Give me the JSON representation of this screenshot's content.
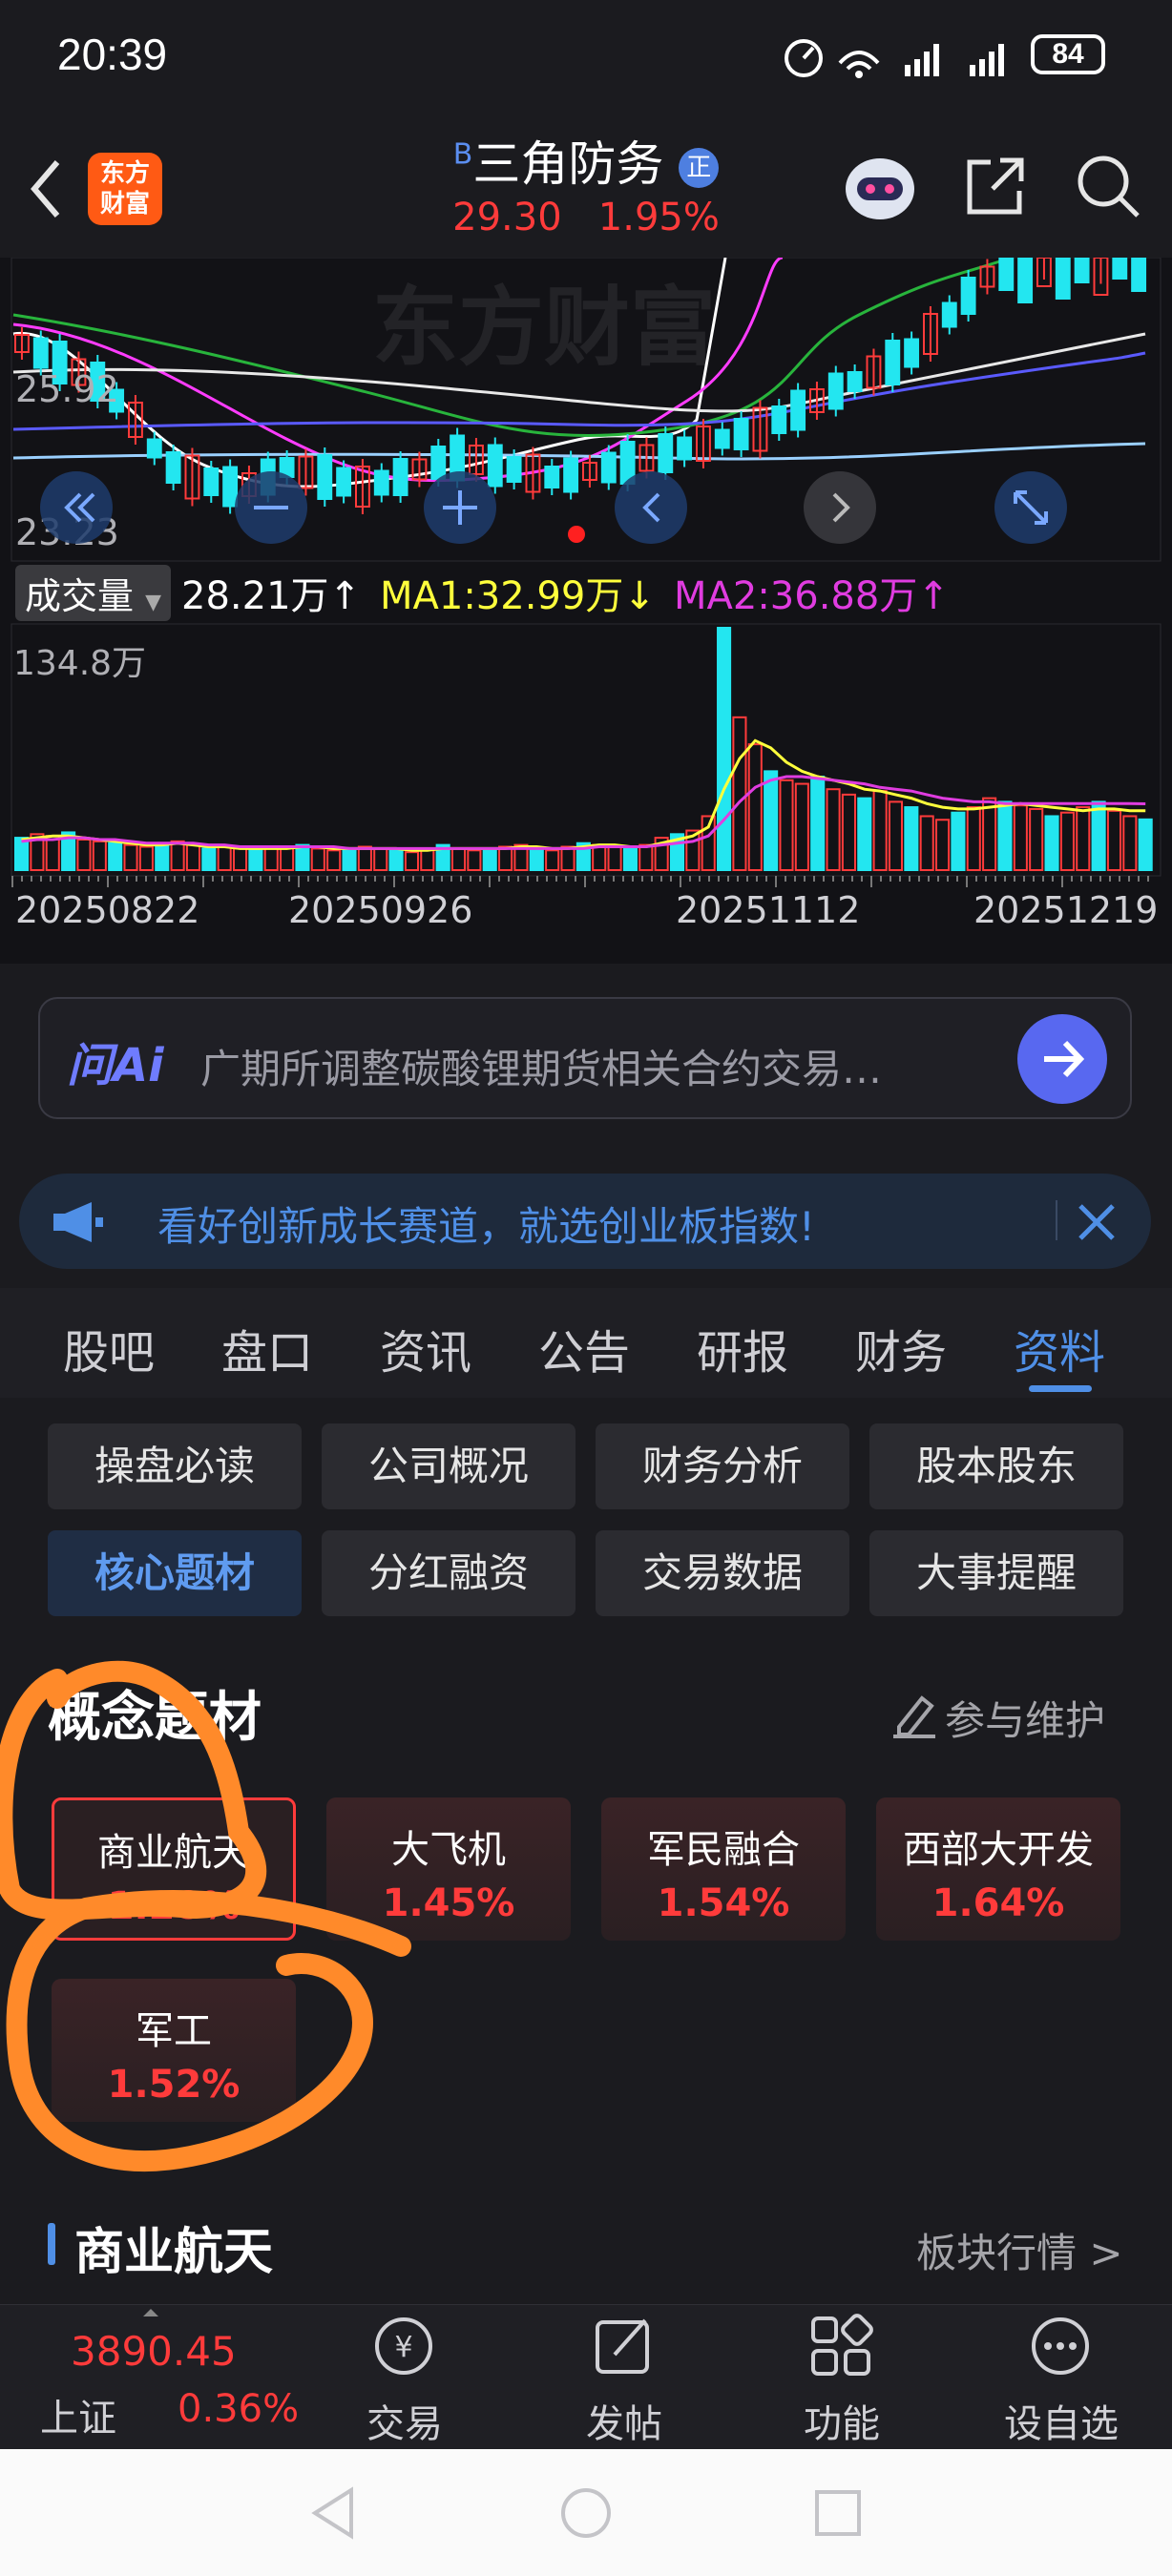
{
  "status_bar": {
    "time": "20:39",
    "battery": "84"
  },
  "header": {
    "logo_line1": "东方",
    "logo_line2": "财富",
    "stock_name": "三角防务",
    "badge_b": "B",
    "badge_zheng": "正",
    "price": "29.30",
    "change_pct": "1.95%"
  },
  "chart": {
    "price_labels": [
      "25.92",
      "23.23"
    ],
    "watermark": "东方财富",
    "volume_selector": "成交量",
    "volume_value": "28.21万↑",
    "ma1": "MA1:32.99万↓",
    "ma2": "MA2:36.88万↑",
    "volume_max": "134.8万",
    "dates": [
      "20250822",
      "20250926",
      "20251112",
      "20251219"
    ]
  },
  "chart_data": {
    "type": "bar",
    "title": "成交量",
    "x": [
      "20250822",
      "20250926",
      "20251112",
      "20251219"
    ],
    "ylim": [
      0,
      134.8
    ],
    "series": [
      {
        "name": "成交量",
        "values": [
          18,
          20,
          19,
          21,
          17,
          16,
          15,
          14,
          13,
          15,
          16,
          14,
          12,
          13,
          12,
          11,
          12,
          13,
          14,
          12,
          11,
          12,
          13,
          12,
          11,
          10,
          12,
          14,
          12,
          11,
          12,
          13,
          14,
          12,
          11,
          13,
          15,
          14,
          13,
          12,
          14,
          18,
          20,
          22,
          30,
          134.8,
          85,
          70,
          55,
          50,
          48,
          52,
          45,
          42,
          40,
          44,
          38,
          35,
          30,
          28,
          32,
          35,
          40,
          38,
          36,
          34,
          30,
          32,
          35,
          38,
          33,
          30,
          28.21
        ]
      },
      {
        "name": "MA1",
        "values": [
          17,
          18,
          19,
          19,
          18,
          17,
          16,
          15,
          14,
          14,
          15,
          14,
          13,
          13,
          12,
          12,
          12,
          12,
          13,
          13,
          12,
          12,
          12,
          12,
          12,
          11,
          11,
          12,
          12,
          12,
          12,
          12,
          13,
          13,
          12,
          12,
          13,
          14,
          14,
          13,
          13,
          15,
          17,
          19,
          24,
          45,
          62,
          72,
          68,
          60,
          55,
          52,
          50,
          48,
          45,
          44,
          42,
          40,
          37,
          35,
          34,
          34,
          35,
          36,
          37,
          36,
          35,
          34,
          33,
          34,
          34,
          33,
          32.99
        ]
      },
      {
        "name": "MA2",
        "values": [
          16,
          17,
          17,
          18,
          18,
          17,
          17,
          16,
          15,
          15,
          15,
          15,
          14,
          14,
          13,
          13,
          13,
          13,
          13,
          13,
          13,
          12,
          12,
          12,
          12,
          12,
          12,
          12,
          12,
          12,
          12,
          12,
          12,
          12,
          12,
          12,
          12,
          13,
          13,
          13,
          13,
          14,
          15,
          16,
          19,
          28,
          38,
          46,
          50,
          52,
          52,
          51,
          50,
          49,
          48,
          46,
          45,
          44,
          42,
          40,
          39,
          38,
          38,
          37,
          37,
          37,
          37,
          37,
          37,
          37,
          37,
          37,
          36.88
        ]
      }
    ]
  },
  "ask_ai": {
    "logo": "问Ai",
    "placeholder": "广期所调整碳酸锂期货相关合约交易…"
  },
  "banner": {
    "text": "看好创新成长赛道，就选创业板指数!"
  },
  "tabs": [
    "股吧",
    "盘口",
    "资讯",
    "公告",
    "研报",
    "财务",
    "资料"
  ],
  "subtabs": [
    "操盘必读",
    "公司概况",
    "财务分析",
    "股本股东",
    "核心题材",
    "分红融资",
    "交易数据",
    "大事提醒"
  ],
  "concept": {
    "title": "概念题材",
    "maintain": "参与维护",
    "items": [
      {
        "name": "商业航天",
        "pct": "1.28%"
      },
      {
        "name": "大飞机",
        "pct": "1.45%"
      },
      {
        "name": "军民融合",
        "pct": "1.54%"
      },
      {
        "name": "西部大开发",
        "pct": "1.64%"
      },
      {
        "name": "军工",
        "pct": "1.52%"
      }
    ]
  },
  "section": {
    "title": "商业航天",
    "link": "板块行情 >"
  },
  "bottom_nav": {
    "index_value": "3890.45",
    "index_name": "上证",
    "index_pct": "0.36%",
    "items": [
      "交易",
      "发帖",
      "功能",
      "设自选"
    ]
  },
  "colors": {
    "up": "#ff3b3b",
    "accent": "#4f8fe6",
    "ma1": "#ffff3c",
    "ma2": "#e03ce0",
    "candle_down": "#23e6f0"
  }
}
